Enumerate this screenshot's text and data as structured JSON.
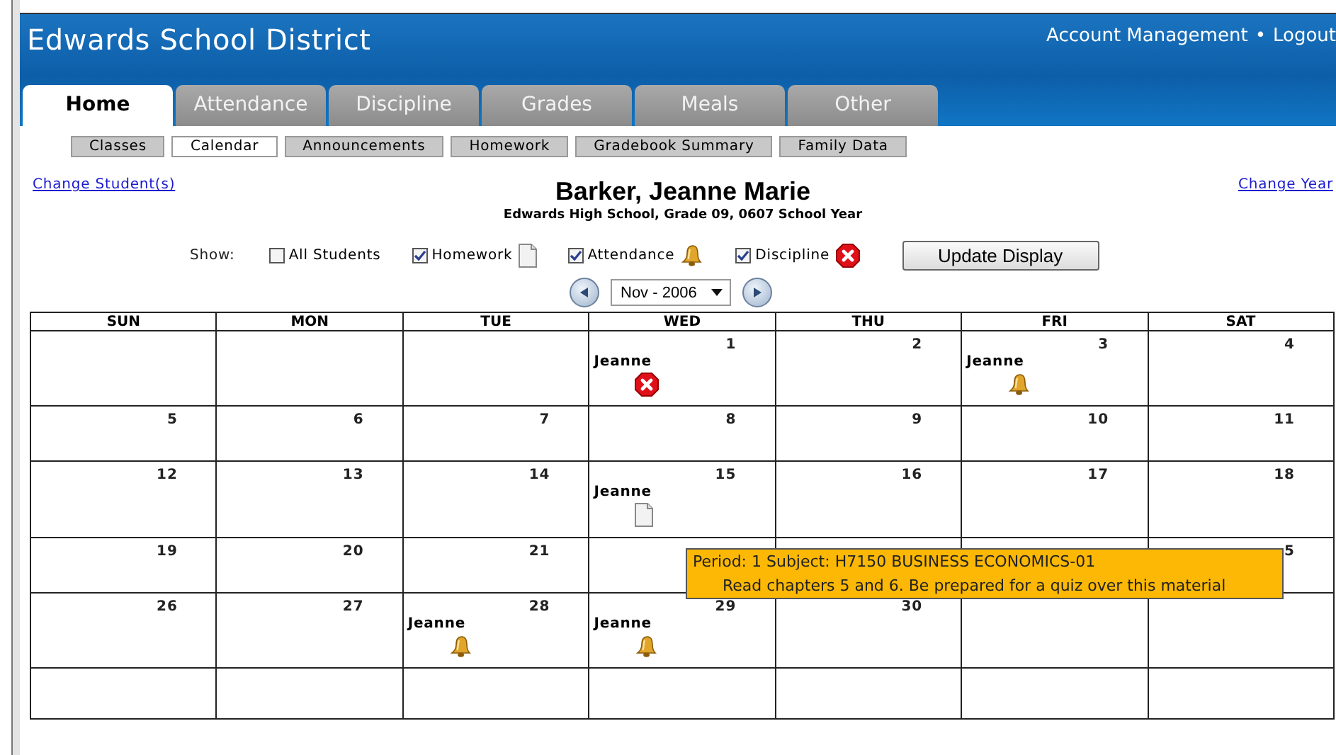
{
  "header": {
    "title": "Edwards School District",
    "links": [
      "Account Management",
      "Logout"
    ],
    "separator": "•"
  },
  "tabs": [
    {
      "label": "Home",
      "selected": true
    },
    {
      "label": "Attendance",
      "selected": false
    },
    {
      "label": "Discipline",
      "selected": false
    },
    {
      "label": "Grades",
      "selected": false
    },
    {
      "label": "Meals",
      "selected": false
    },
    {
      "label": "Other",
      "selected": false
    }
  ],
  "subtabs": [
    {
      "label": "Classes",
      "selected": false
    },
    {
      "label": "Calendar",
      "selected": true
    },
    {
      "label": "Announcements",
      "selected": false
    },
    {
      "label": "Homework",
      "selected": false
    },
    {
      "label": "Gradebook Summary",
      "selected": false
    },
    {
      "label": "Family Data",
      "selected": false
    }
  ],
  "change_student": "Change Student(s)",
  "change_year": "Change Year",
  "student": {
    "name": "Barker, Jeanne Marie",
    "details": "Edwards High School, Grade 09, 0607 School Year"
  },
  "show": {
    "label": "Show:",
    "options": [
      {
        "label": "All Students",
        "checked": false
      },
      {
        "label": "Homework",
        "checked": true,
        "kind": "homework"
      },
      {
        "label": "Attendance",
        "checked": true,
        "kind": "attendance"
      },
      {
        "label": "Discipline",
        "checked": true,
        "kind": "discipline"
      }
    ],
    "button": "Update Display"
  },
  "month": "Nov - 2006",
  "calendar": {
    "days": [
      "SUN",
      "MON",
      "TUE",
      "WED",
      "THU",
      "FRI",
      "SAT"
    ],
    "weeks": [
      [
        {
          "kind": "blank"
        },
        {
          "kind": "blank"
        },
        {
          "kind": "blank"
        },
        {
          "kind": "day",
          "day": "1",
          "entries": [
            {
              "student": "Jeanne",
              "kind": "discipline"
            }
          ]
        },
        {
          "kind": "day",
          "day": "2"
        },
        {
          "kind": "day",
          "day": "3",
          "entries": [
            {
              "student": "Jeanne",
              "kind": "attendance"
            }
          ]
        },
        {
          "kind": "day",
          "day": "4"
        }
      ],
      [
        {
          "kind": "day",
          "day": "5"
        },
        {
          "kind": "day",
          "day": "6"
        },
        {
          "kind": "day",
          "day": "7"
        },
        {
          "kind": "day",
          "day": "8"
        },
        {
          "kind": "day",
          "day": "9"
        },
        {
          "kind": "day",
          "day": "10"
        },
        {
          "kind": "day",
          "day": "11"
        }
      ],
      [
        {
          "kind": "day",
          "day": "12"
        },
        {
          "kind": "day",
          "day": "13"
        },
        {
          "kind": "day",
          "day": "14"
        },
        {
          "kind": "day",
          "day": "15",
          "entries": [
            {
              "student": "Jeanne",
              "kind": "homework"
            }
          ]
        },
        {
          "kind": "day",
          "day": "16"
        },
        {
          "kind": "day",
          "day": "17"
        },
        {
          "kind": "day",
          "day": "18"
        }
      ],
      [
        {
          "kind": "day",
          "day": "19"
        },
        {
          "kind": "day",
          "day": "20"
        },
        {
          "kind": "day",
          "day": "21"
        },
        {
          "kind": "blank"
        },
        {
          "kind": "blank"
        },
        {
          "kind": "blank"
        },
        {
          "kind": "day",
          "day": "5"
        }
      ],
      [
        {
          "kind": "day",
          "day": "26"
        },
        {
          "kind": "day",
          "day": "27"
        },
        {
          "kind": "day",
          "day": "28",
          "entries": [
            {
              "student": "Jeanne",
              "kind": "attendance"
            }
          ]
        },
        {
          "kind": "day",
          "day": "29",
          "entries": [
            {
              "student": "Jeanne",
              "kind": "attendance"
            }
          ]
        },
        {
          "kind": "day",
          "day": "30"
        },
        {
          "kind": "blank"
        },
        {
          "kind": "blank"
        }
      ],
      [
        {
          "kind": "blank"
        },
        {
          "kind": "blank"
        },
        {
          "kind": "blank"
        },
        {
          "kind": "blank"
        },
        {
          "kind": "blank"
        },
        {
          "kind": "blank"
        },
        {
          "kind": "blank"
        }
      ]
    ]
  },
  "tooltip": {
    "title": "Period: 1 Subject: H7150 BUSINESS ECONOMICS-01",
    "text": "Read chapters 5 and 6. Be prepared for a quiz over this material"
  }
}
